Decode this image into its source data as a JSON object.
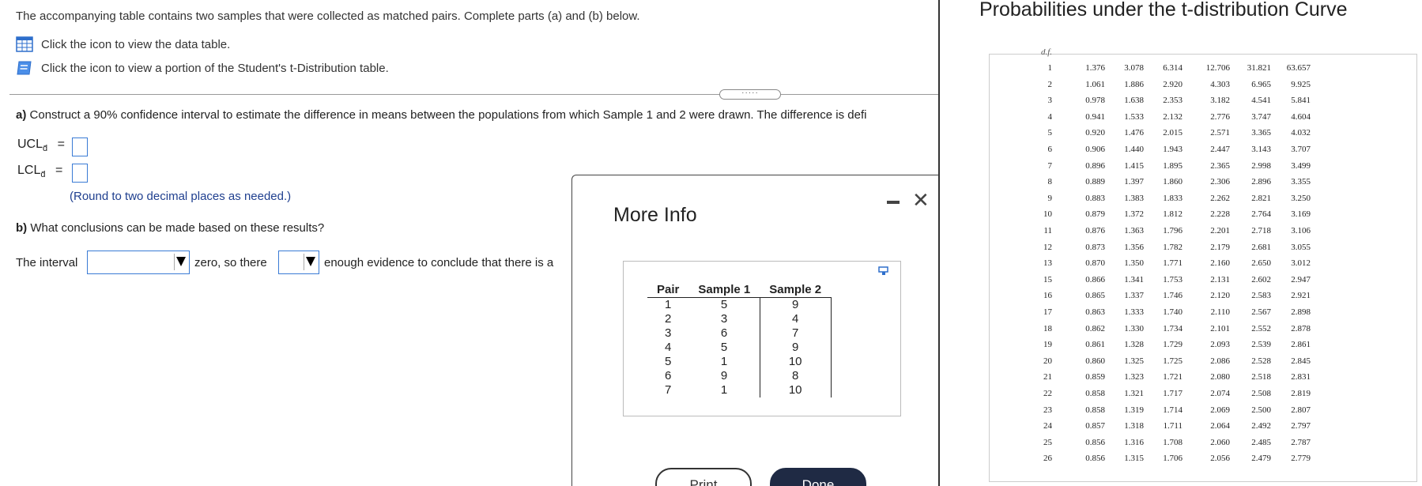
{
  "intro": "The accompanying table contains two samples that were collected as matched pairs. Complete parts (a) and (b) below.",
  "links": {
    "data_table": "Click the icon to view the data table.",
    "t_table": "Click the icon to view a portion of the Student's t-Distribution table."
  },
  "expander_label": "·····",
  "part_a": {
    "label": "a)",
    "text": "Construct a 90% confidence interval to estimate the difference in means between the populations from which Sample 1 and 2 were drawn. The difference is defi",
    "ucl_label": "UCL",
    "lcl_label": "LCL",
    "subscript": "d̄",
    "equals": "=",
    "hint": "(Round to two decimal places as needed.)"
  },
  "part_b": {
    "label": "b)",
    "text": "What conclusions can be made based on these results?",
    "sentence_1": "The interval",
    "sentence_2": "zero, so there",
    "sentence_3": "enough evidence to conclude that there is a"
  },
  "modal": {
    "title": "More Info",
    "headers": [
      "Pair",
      "Sample 1",
      "Sample 2"
    ],
    "rows": [
      [
        "1",
        "5",
        "9"
      ],
      [
        "2",
        "3",
        "4"
      ],
      [
        "3",
        "6",
        "7"
      ],
      [
        "4",
        "5",
        "9"
      ],
      [
        "5",
        "1",
        "10"
      ],
      [
        "6",
        "9",
        "8"
      ],
      [
        "7",
        "1",
        "10"
      ]
    ],
    "print_label": "Print",
    "done_label": "Done",
    "close_glyph": "✕"
  },
  "t_table": {
    "title": "Probabilities under the t-distribution Curve",
    "df_header": "d.f.",
    "rows": [
      [
        "1",
        "1.376",
        "3.078",
        "6.314",
        "12.706",
        "31.821",
        "63.657"
      ],
      [
        "2",
        "1.061",
        "1.886",
        "2.920",
        "4.303",
        "6.965",
        "9.925"
      ],
      [
        "3",
        "0.978",
        "1.638",
        "2.353",
        "3.182",
        "4.541",
        "5.841"
      ],
      [
        "4",
        "0.941",
        "1.533",
        "2.132",
        "2.776",
        "3.747",
        "4.604"
      ],
      [
        "5",
        "0.920",
        "1.476",
        "2.015",
        "2.571",
        "3.365",
        "4.032"
      ],
      [
        "6",
        "0.906",
        "1.440",
        "1.943",
        "2.447",
        "3.143",
        "3.707"
      ],
      [
        "7",
        "0.896",
        "1.415",
        "1.895",
        "2.365",
        "2.998",
        "3.499"
      ],
      [
        "8",
        "0.889",
        "1.397",
        "1.860",
        "2.306",
        "2.896",
        "3.355"
      ],
      [
        "9",
        "0.883",
        "1.383",
        "1.833",
        "2.262",
        "2.821",
        "3.250"
      ],
      [
        "10",
        "0.879",
        "1.372",
        "1.812",
        "2.228",
        "2.764",
        "3.169"
      ],
      [
        "11",
        "0.876",
        "1.363",
        "1.796",
        "2.201",
        "2.718",
        "3.106"
      ],
      [
        "12",
        "0.873",
        "1.356",
        "1.782",
        "2.179",
        "2.681",
        "3.055"
      ],
      [
        "13",
        "0.870",
        "1.350",
        "1.771",
        "2.160",
        "2.650",
        "3.012"
      ],
      [
        "15",
        "0.866",
        "1.341",
        "1.753",
        "2.131",
        "2.602",
        "2.947"
      ],
      [
        "16",
        "0.865",
        "1.337",
        "1.746",
        "2.120",
        "2.583",
        "2.921"
      ],
      [
        "17",
        "0.863",
        "1.333",
        "1.740",
        "2.110",
        "2.567",
        "2.898"
      ],
      [
        "18",
        "0.862",
        "1.330",
        "1.734",
        "2.101",
        "2.552",
        "2.878"
      ],
      [
        "19",
        "0.861",
        "1.328",
        "1.729",
        "2.093",
        "2.539",
        "2.861"
      ],
      [
        "20",
        "0.860",
        "1.325",
        "1.725",
        "2.086",
        "2.528",
        "2.845"
      ],
      [
        "21",
        "0.859",
        "1.323",
        "1.721",
        "2.080",
        "2.518",
        "2.831"
      ],
      [
        "22",
        "0.858",
        "1.321",
        "1.717",
        "2.074",
        "2.508",
        "2.819"
      ],
      [
        "23",
        "0.858",
        "1.319",
        "1.714",
        "2.069",
        "2.500",
        "2.807"
      ],
      [
        "24",
        "0.857",
        "1.318",
        "1.711",
        "2.064",
        "2.492",
        "2.797"
      ],
      [
        "25",
        "0.856",
        "1.316",
        "1.708",
        "2.060",
        "2.485",
        "2.787"
      ],
      [
        "26",
        "0.856",
        "1.315",
        "1.706",
        "2.056",
        "2.479",
        "2.779"
      ]
    ]
  },
  "colors": {
    "accent_blue": "#3a7bd5",
    "hint_blue": "#1f3f8f",
    "done_button": "#1f2a44"
  },
  "icons": {
    "data_table": "table-icon",
    "t_table": "book-icon",
    "dropdown": "triangle-down-icon",
    "close": "close-icon",
    "minimize": "minimize-icon",
    "copy": "copy-icon"
  }
}
